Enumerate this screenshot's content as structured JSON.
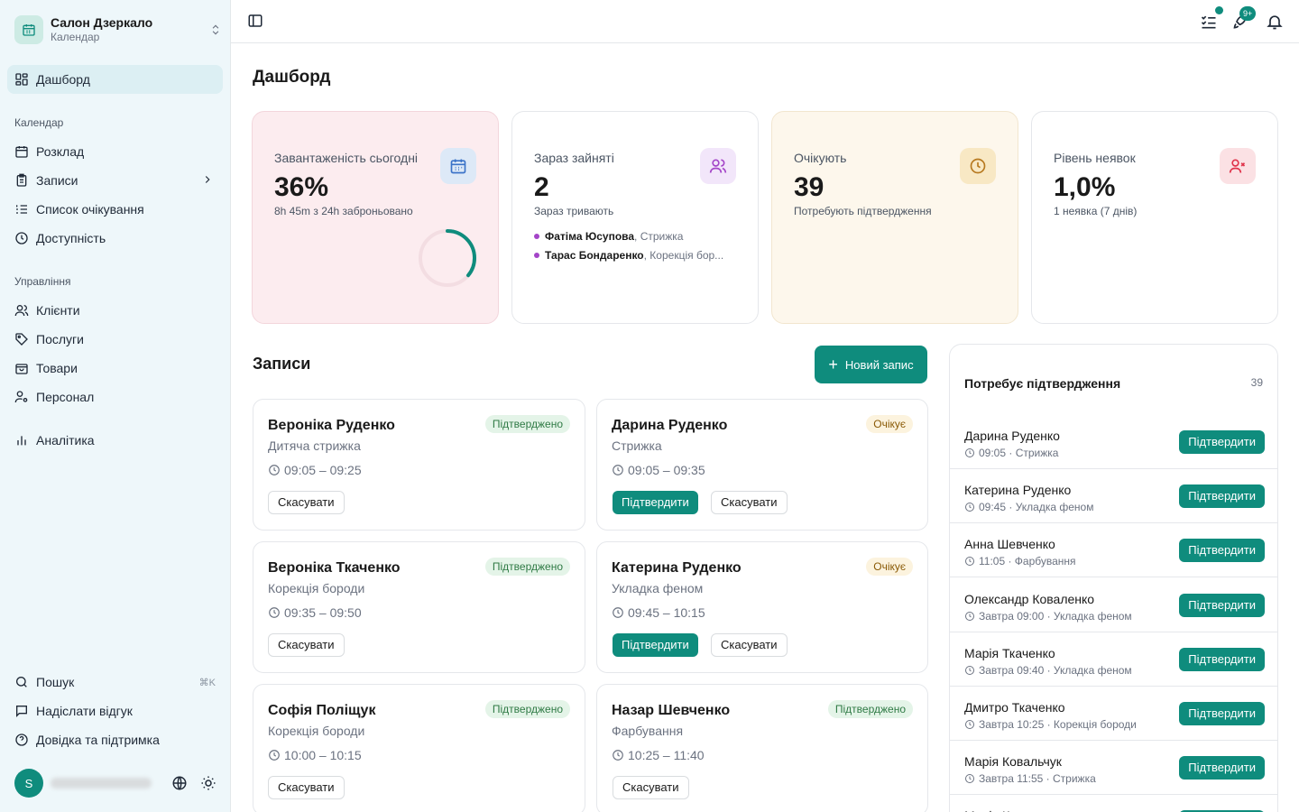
{
  "sidebar": {
    "brand_title": "Салон Дзеркало",
    "brand_sub": "Календар",
    "dashboard": "Дашборд",
    "group_calendar": "Календар",
    "schedule": "Розклад",
    "appointments": "Записи",
    "waitlist": "Список очікування",
    "availability": "Доступність",
    "group_manage": "Управління",
    "clients": "Клієнти",
    "services": "Послуги",
    "products": "Товари",
    "staff": "Персонал",
    "analytics": "Аналітика",
    "search": "Пошук",
    "search_kbd": "⌘K",
    "feedback": "Надіслати відгук",
    "help": "Довідка та підтримка",
    "avatar_letter": "S"
  },
  "topbar": {
    "badge": "9+"
  },
  "page": {
    "title": "Дашборд"
  },
  "stats": {
    "load": {
      "label": "Завантаженість сьогодні",
      "value": "36%",
      "sub": "8h 45m з 24h заброньовано",
      "percent": 36
    },
    "busy": {
      "label": "Зараз зайняті",
      "value": "2",
      "sub": "Зараз тривають",
      "items": [
        {
          "name": "Фатіма Юсупова",
          "service": ", Стрижка"
        },
        {
          "name": "Тарас Бондаренко",
          "service": ", Корекція бор..."
        }
      ]
    },
    "waiting": {
      "label": "Очікують",
      "value": "39",
      "sub": "Потребують підтвердження"
    },
    "noshow": {
      "label": "Рівень неявок",
      "value": "1,0%",
      "sub": "1 неявка (7 днів)"
    }
  },
  "appointments": {
    "title": "Записи",
    "new_button": "Новий запис",
    "confirm_label": "Підтвердити",
    "cancel_label": "Скасувати",
    "items": [
      {
        "name": "Вероніка Руденко",
        "service": "Дитяча стрижка",
        "time": "09:05 – 09:25",
        "status": "Підтверджено"
      },
      {
        "name": "Дарина Руденко",
        "service": "Стрижка",
        "time": "09:05 – 09:35",
        "status": "Очікує"
      },
      {
        "name": "Вероніка Ткаченко",
        "service": "Корекція бороди",
        "time": "09:35 – 09:50",
        "status": "Підтверджено"
      },
      {
        "name": "Катерина Руденко",
        "service": "Укладка феном",
        "time": "09:45 – 10:15",
        "status": "Очікує"
      },
      {
        "name": "Софія Поліщук",
        "service": "Корекція бороди",
        "time": "10:00 – 10:15",
        "status": "Підтверджено"
      },
      {
        "name": "Назар Шевченко",
        "service": "Фарбування",
        "time": "10:25 – 11:40",
        "status": "Підтверджено"
      }
    ]
  },
  "pending": {
    "title": "Потребує підтвердження",
    "count": "39",
    "button": "Підтвердити",
    "items": [
      {
        "name": "Дарина Руденко",
        "meta": "09:05 · Стрижка"
      },
      {
        "name": "Катерина Руденко",
        "meta": "09:45 · Укладка феном"
      },
      {
        "name": "Анна Шевченко",
        "meta": "11:05 · Фарбування"
      },
      {
        "name": "Олександр Коваленко",
        "meta": "Завтра 09:00 · Укладка феном"
      },
      {
        "name": "Марія Ткаченко",
        "meta": "Завтра 09:40 · Укладка феном"
      },
      {
        "name": "Дмитро Ткаченко",
        "meta": "Завтра 10:25 · Корекція бороди"
      },
      {
        "name": "Марія Ковальчук",
        "meta": "Завтра 11:55 · Стрижка"
      },
      {
        "name": "Марія Коваленко",
        "meta": ""
      }
    ]
  },
  "colors": {
    "accent": "#0f8c7d",
    "sidebar_bg": "#eef7fa",
    "load_card_bg": "#fcecef",
    "waiting_card_bg": "#fdf7ec",
    "busy_dot": "#a445c8",
    "noshow_icon": "#e0334b"
  }
}
